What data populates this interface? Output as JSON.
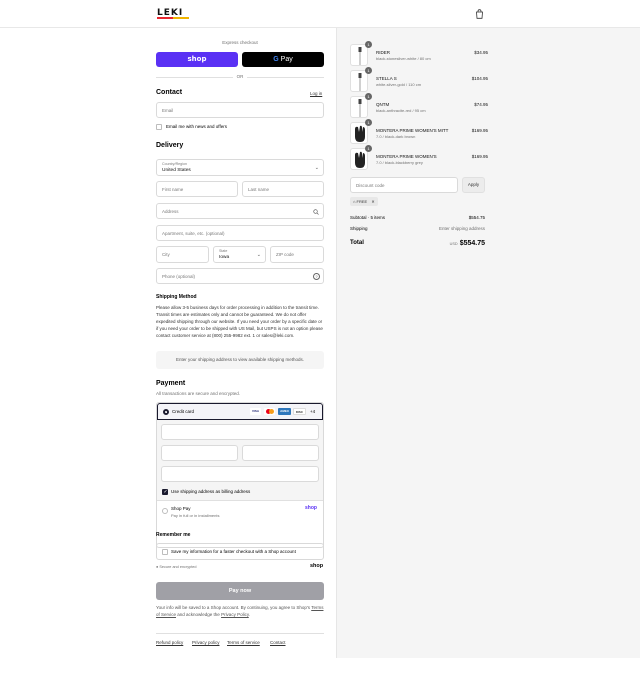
{
  "header": {
    "logo": "LEKI",
    "cart_icon": "bag-icon"
  },
  "express": {
    "label": "Express checkout",
    "shop_label": "shop",
    "gpay_label": "Pay",
    "gpay_g": "G",
    "or_label": "OR"
  },
  "contact": {
    "title": "Contact",
    "login_label": "Log in",
    "email_placeholder": "Email",
    "newsletter_label": "Email me with news and offers"
  },
  "delivery": {
    "title": "Delivery",
    "country_label": "Country/Region",
    "country_value": "United States",
    "first_name_placeholder": "First name",
    "last_name_placeholder": "Last name",
    "address_placeholder": "Address",
    "apartment_placeholder": "Apartment, suite, etc. (optional)",
    "city_placeholder": "City",
    "state_label": "State",
    "state_value": "Iowa",
    "zip_placeholder": "ZIP code",
    "phone_placeholder": "Phone (optional)"
  },
  "shipping": {
    "title": "Shipping Method",
    "policy": "Please allow 3-5 business days for order processing in addition to the transit time. Transit times are estimates only and cannot be guaranteed. We do not offer expedited shipping through our website. If you need your order by a specific date or if you need your order to be shipped with US Mail, but USPS is not an option please contact customer service at (800) 255-9982 ext. 1 or sales@leki.com.",
    "notice": "Enter your shipping address to view available shipping methods."
  },
  "payment": {
    "title": "Payment",
    "subtitle": "All transactions are secure and encrypted.",
    "credit_card_label": "Credit card",
    "card_brands": [
      "VISA",
      "MC",
      "AMEX",
      "DISC"
    ],
    "more_cards": "+4",
    "billing_label": "Use shipping address as billing address",
    "shop_pay_label": "Shop Pay",
    "shop_pay_sub": "Pay in full or in installments",
    "shop_pay_logo": "shop"
  },
  "remember": {
    "title": "Remember me",
    "save_label": "Save my information for a faster checkout with a Shop account",
    "secure_label": "Secure and encrypted",
    "shop_logo": "shop"
  },
  "pay_button": "Pay now",
  "legal": {
    "before": "Your info will be saved to a Shop account. By continuing, you agree to Shop's ",
    "terms": "Terms of Service",
    "middle": " and acknowledge the ",
    "privacy": "Privacy Policy",
    "after": "."
  },
  "footer": [
    "Refund policy",
    "Privacy policy",
    "Terms of service",
    "Contact"
  ],
  "cart": {
    "items": [
      {
        "qty": "1",
        "name": "RIDER",
        "variant": "black-stonesilver-white / 80 cm",
        "price": "$34.95",
        "kind": "pole"
      },
      {
        "qty": "1",
        "name": "STELLA S",
        "variant": "white-silver-gold / 110 cm",
        "price": "$104.95",
        "kind": "pole"
      },
      {
        "qty": "1",
        "name": "QNTM",
        "variant": "black-anthracite-red / 95 cm",
        "price": "$74.95",
        "kind": "pole"
      },
      {
        "qty": "1",
        "name": "MONTERA PRIME WOMEN'S MITT",
        "variant": "7.0 / black-dark brown",
        "price": "$169.95",
        "kind": "glove"
      },
      {
        "qty": "1",
        "name": "MONTERA PRIME WOMEN'S",
        "variant": "7.0 / black-blackberry grey",
        "price": "$169.95",
        "kind": "glove"
      }
    ],
    "discount_placeholder": "Discount code",
    "apply_label": "Apply",
    "tag_label": "FREE",
    "subtotal_label": "Subtotal · 5 items",
    "subtotal_value": "$554.75",
    "shipping_label": "Shipping",
    "shipping_value": "Enter shipping address",
    "total_label": "Total",
    "currency": "USD",
    "total_value": "$554.75"
  }
}
